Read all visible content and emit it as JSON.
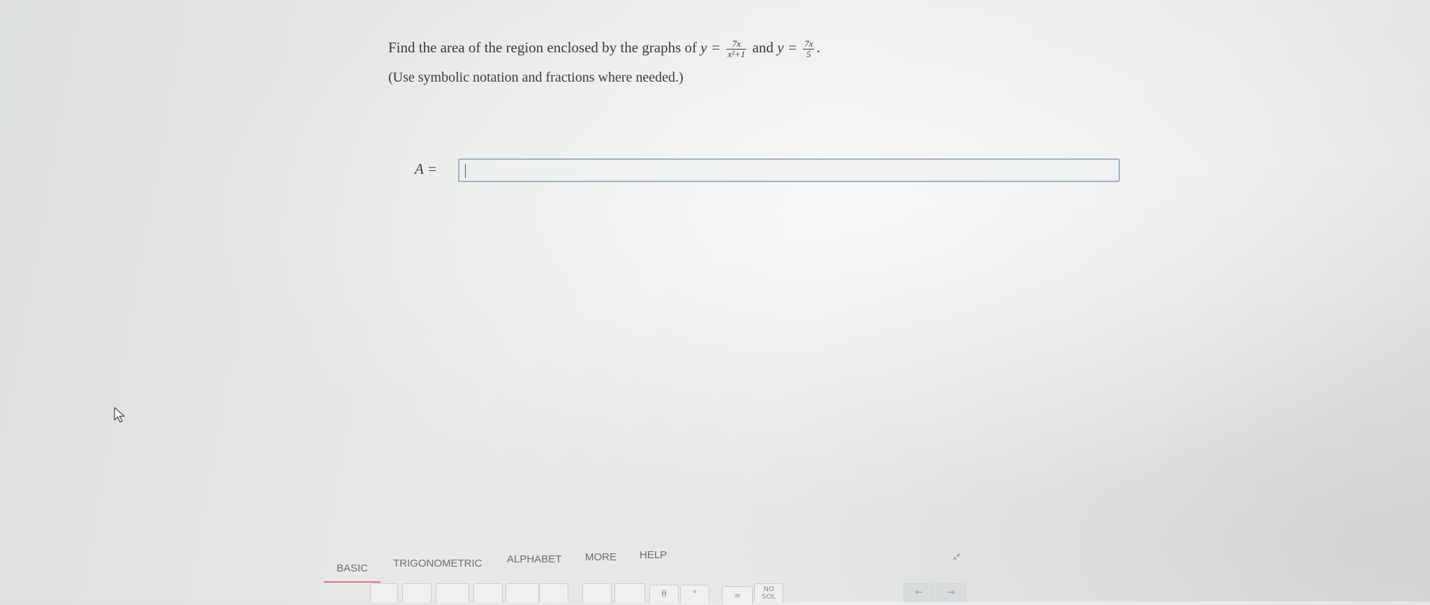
{
  "question": {
    "prefix": "Find the area of the region enclosed by the graphs of",
    "y1_lhs": "y =",
    "y1_num": "7x",
    "y1_den": "x²+1",
    "connector": "and",
    "y2_lhs": "y =",
    "y2_num": "7x",
    "y2_den": "5",
    "end": "."
  },
  "hint": "(Use symbolic notation and fractions where needed.)",
  "answer": {
    "label": "A =",
    "value": ""
  },
  "tabs": [
    {
      "label": "BASIC",
      "active": true
    },
    {
      "label": "TRIGONOMETRIC",
      "active": false
    },
    {
      "label": "ALPHABET",
      "active": false
    },
    {
      "label": "MORE",
      "active": false
    },
    {
      "label": "HELP",
      "active": false
    }
  ],
  "keys": {
    "theta": "θ",
    "degree": "°",
    "infinity": "∞",
    "nosol_line1": "NO",
    "nosol_line2": "SOL",
    "left_arrow": "←",
    "right_arrow": "→"
  },
  "icons": {
    "cursor": "mouse-pointer-icon",
    "collapse": "collapse-keyboard-icon"
  },
  "colors": {
    "active_tab_underline": "#e57373",
    "input_border": "#9fb4c4"
  }
}
